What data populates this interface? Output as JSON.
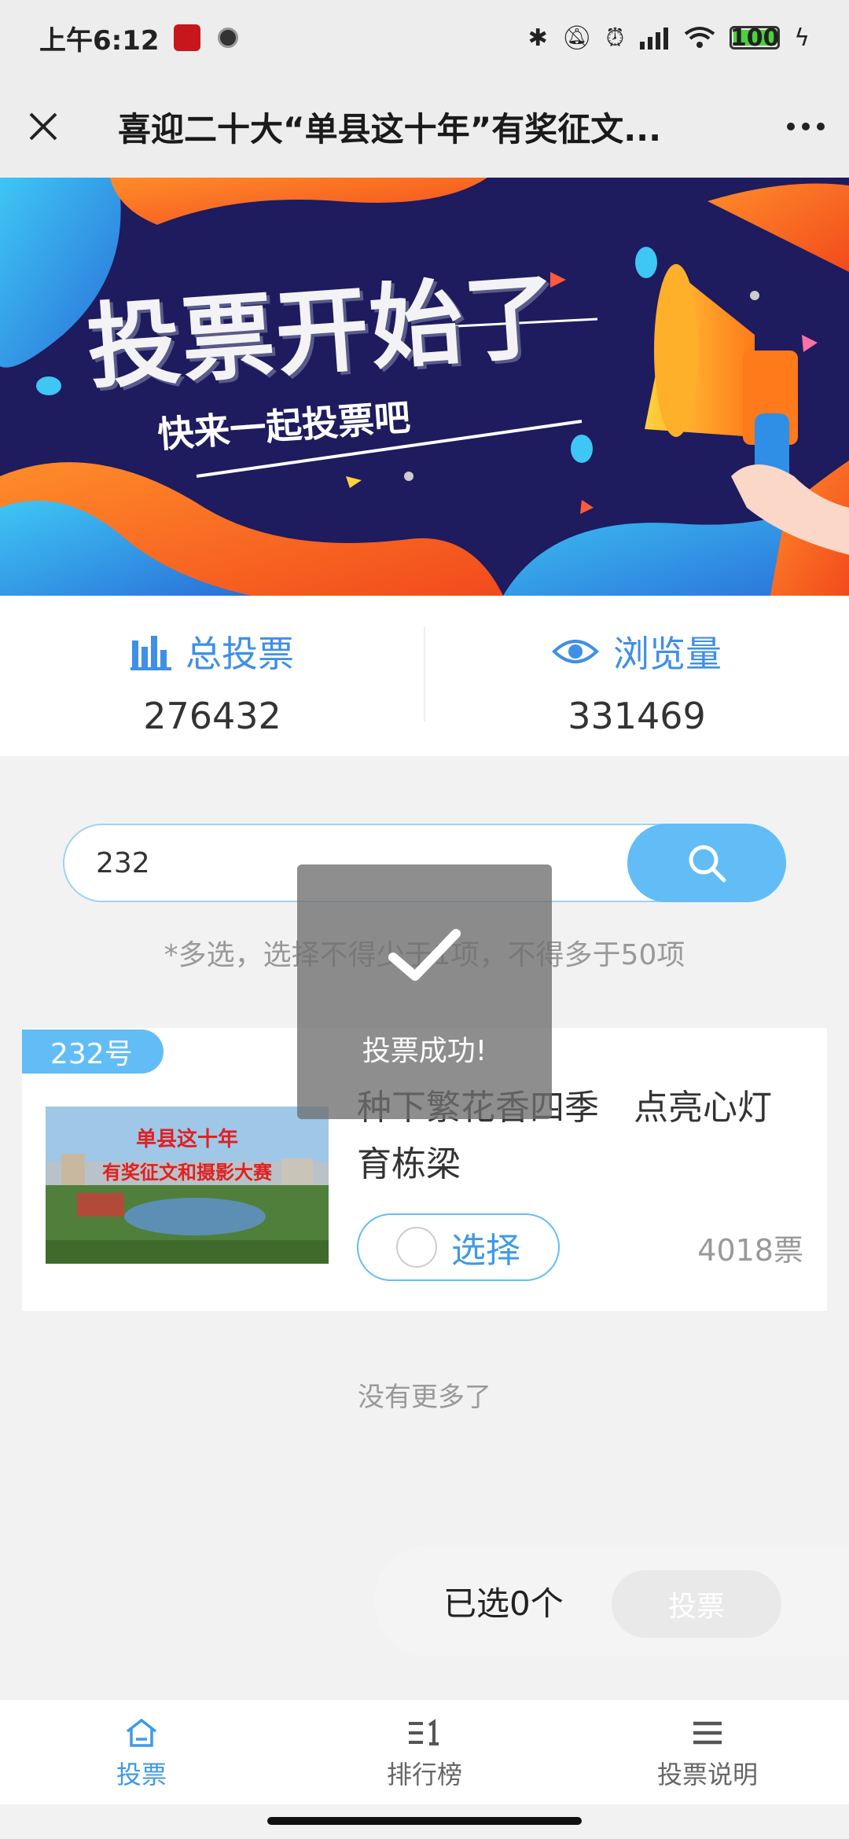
{
  "status_bar": {
    "time": "上午6:12",
    "battery": "100"
  },
  "header": {
    "title": "喜迎二十大“单县这十年”有奖征文..."
  },
  "banner": {
    "title": "投票开始了",
    "subtitle": "快来一起投票吧"
  },
  "stats": {
    "total_votes_label": "总投票",
    "total_votes_value": "276432",
    "views_label": "浏览量",
    "views_value": "331469"
  },
  "search": {
    "value": "232"
  },
  "hint": "*多选，选择不得少于1项，不得多于50项",
  "card": {
    "badge": "232号",
    "image_text_1": "单县这十年",
    "image_text_2": "有奖征文和摄影大赛",
    "title": "种下繁花香四季　点亮心灯育栋梁",
    "select_label": "选择",
    "votes": "4018票"
  },
  "no_more": "没有更多了",
  "vote_bar": {
    "selected": "已选0个",
    "vote_button": "投票"
  },
  "tabs": [
    {
      "label": "投票",
      "icon": "home-icon"
    },
    {
      "label": "排行榜",
      "icon": "ranking-icon"
    },
    {
      "label": "投票说明",
      "icon": "menu-icon"
    }
  ],
  "toast": {
    "message": "投票成功!"
  },
  "colors": {
    "accent": "#62bdf6",
    "accent_text": "#3f9ae6",
    "stat_blue": "#3f8fe6"
  }
}
